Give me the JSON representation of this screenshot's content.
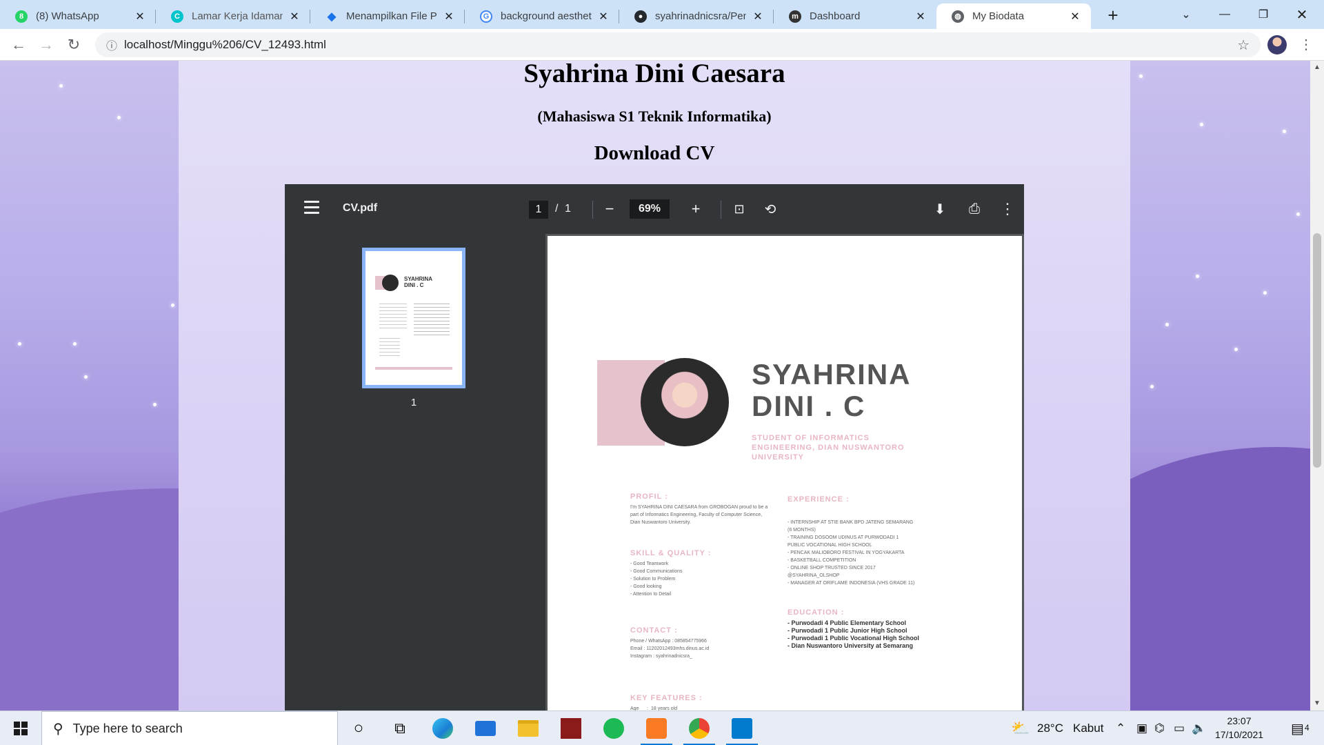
{
  "browser": {
    "tabs": [
      {
        "title": "(8) WhatsApp",
        "icon": "whatsapp-icon",
        "color": "#25d366",
        "badge": "8"
      },
      {
        "title": "Lamar Kerja Idaman di",
        "icon": "canva-icon",
        "color": "#00c4cc"
      },
      {
        "title": "Menampilkan File PDF",
        "icon": "diamond-icon",
        "color": "#1a73e8"
      },
      {
        "title": "background aesthetic",
        "icon": "google-icon",
        "color": "#4285f4"
      },
      {
        "title": "syahrinadnicsra/Pem",
        "icon": "github-icon",
        "color": "#24292e"
      },
      {
        "title": "Dashboard",
        "icon": "moodle-icon",
        "color": "#333333"
      },
      {
        "title": "My Biodata",
        "icon": "globe-icon",
        "color": "#5f6368"
      }
    ],
    "url": "localhost/Minggu%206/CV_12493.html"
  },
  "page": {
    "name": "Syahrina Dini Caesara",
    "subtitle": "(Mahasiswa S1 Teknik Informatika)",
    "download_heading": "Download CV"
  },
  "pdf_viewer": {
    "filename": "CV.pdf",
    "current_page": "1",
    "separator": "/",
    "total_pages": "1",
    "zoom": "69%",
    "thumb_label": "1"
  },
  "cv": {
    "name_line1": "SYAHRINA",
    "name_line2": "DINI . C",
    "subtitle": "STUDENT OF INFORMATICS ENGINEERING, DIAN NUSWANTORO UNIVERSITY",
    "profil_heading": "PROFIL :",
    "profil_text": "I'm SYAHRINA DINI CAESARA from GROBOGAN proud to be a\npart of Informatics Engineering, Faculty of Computer Science,\nDian Nuswantoro University.",
    "skill_heading": "SKILL & QUALITY :",
    "skill_text": "- Good Teamwork\n- Good Communications\n- Solution to Problem\n- Good looking\n- Attention to Detail",
    "contact_heading": "CONTACT :",
    "contact_text": "Phone / WhatsApp : 085854775966\nEmail : 11202012493mhs.dinus.ac.id\nInstagram : syahrinadnicsra_",
    "keyfeat_heading": "KEY FEATURES :",
    "keyfeat_text": "Age      :  18 years old",
    "experience_heading": "EXPERIENCE :",
    "experience_text": "- INTERNSHIP AT STIE BANK BPD JATENG SEMARANG\n(6 MONTHS)\n- TRAINING DOSOOM UDINUS AT PURWODADI 1\nPUBLIC VOCATIONAL HIGH SCHOOL\n- PENCAK MALIOBORO FESTIVAL IN YOGYAKARTA\n- BASKETBALL COMPETITION\n- ONLINE SHOP TRUSTED SINCE 2017\n@SYAHRINA_OLSHOP\n- MANAGER AT ORIFLAME INDONESIA (VHS GRADE 11)",
    "education_heading": "EDUCATION :",
    "education_text": "- Purwodadi 4 Public Elementary School\n- Purwodadi 1 Public Junior High School\n- Purwodadi 1 Public Vocational High School\n- Dian Nuswantoro University at Semarang",
    "thumb_name": "SYAHRINA\nDINI . C"
  },
  "taskbar": {
    "search_placeholder": "Type here to search",
    "weather_temp": "28°C",
    "weather_desc": "Kabut",
    "time": "23:07",
    "date": "17/10/2021",
    "notification_count": "4"
  }
}
